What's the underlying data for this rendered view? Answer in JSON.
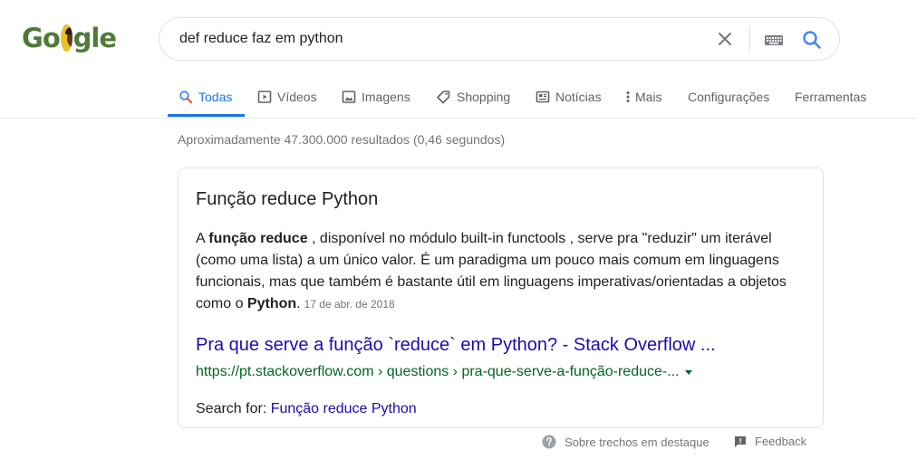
{
  "logo": {
    "alt": "Google"
  },
  "search": {
    "query": "def reduce faz em python"
  },
  "tabs": [
    {
      "label": "Todas",
      "icon": "search-icon"
    },
    {
      "label": "Vídeos",
      "icon": "video-icon"
    },
    {
      "label": "Imagens",
      "icon": "image-icon"
    },
    {
      "label": "Shopping",
      "icon": "tag-icon"
    },
    {
      "label": "Notícias",
      "icon": "news-icon"
    },
    {
      "label": "Mais",
      "icon": "more-vert-icon"
    },
    {
      "label": "Configurações"
    },
    {
      "label": "Ferramentas"
    }
  ],
  "result_stats": "Aproximadamente 47.300.000 resultados (0,46 segundos)",
  "snippet": {
    "title": "Função reduce Python",
    "body_1": "A ",
    "body_bold_1": "função reduce",
    "body_2": " , disponível no módulo built-in functools , serve pra \"reduzir\" um iterável (como uma lista) a um único valor. É um paradigma um pouco mais comum em linguagens funcionais, mas que também é bastante útil em linguagens imperativas/orientadas a objetos como o ",
    "body_bold_2": "Python",
    "body_3": ".",
    "date": "17 de abr. de 2018",
    "link_title": "Pra que serve a função `reduce` em Python? - Stack Overflow ...",
    "url": "https://pt.stackoverflow.com › questions › pra-que-serve-a-função-reduce-...",
    "search_for_label": "Search for: ",
    "search_for_link": "Função reduce Python"
  },
  "footer": {
    "about_label": "Sobre trechos em destaque",
    "feedback_label": "Feedback"
  },
  "colors": {
    "accent": "#1a73e8",
    "link": "#1a0dab",
    "url_green": "#006621",
    "muted": "#70757a"
  }
}
